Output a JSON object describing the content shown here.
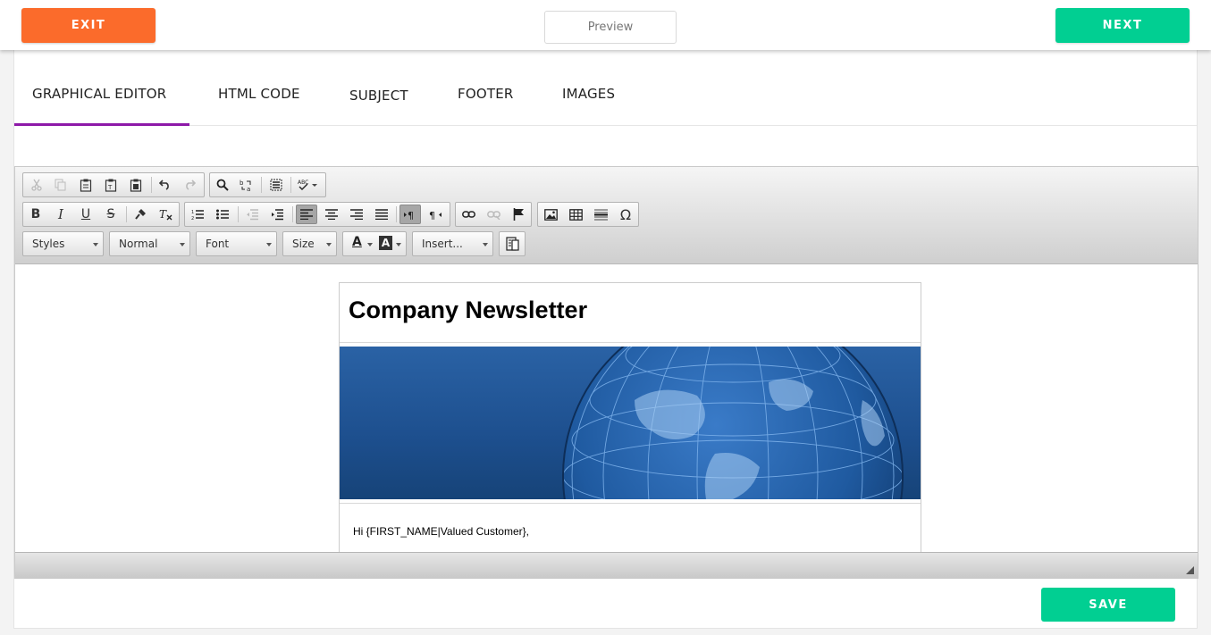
{
  "header": {
    "exit_label": "EXIT",
    "preview_label": "Preview",
    "next_label": "NEXT"
  },
  "tabs": [
    {
      "label": "GRAPHICAL EDITOR",
      "active": true
    },
    {
      "label": "HTML CODE"
    },
    {
      "label": "SUBJECT"
    },
    {
      "label": "FOOTER"
    },
    {
      "label": "IMAGES"
    }
  ],
  "toolbar": {
    "row1": [
      "cut-icon",
      "copy-icon",
      "paste-icon",
      "paste-text-icon",
      "paste-word-icon",
      "undo-icon",
      "redo-icon",
      "find-icon",
      "replace-icon",
      "select-all-icon",
      "spellcheck-icon"
    ],
    "row2": [
      "bold-icon",
      "italic-icon",
      "underline-icon",
      "strikethrough-icon",
      "format-painter-icon",
      "remove-format-icon",
      "numbered-list-icon",
      "bulleted-list-icon",
      "outdent-icon",
      "indent-icon",
      "align-left-icon",
      "align-center-icon",
      "align-right-icon",
      "justify-icon",
      "ltr-icon",
      "rtl-icon",
      "link-icon",
      "unlink-icon",
      "anchor-icon",
      "image-icon",
      "table-icon",
      "horizontal-line-icon",
      "special-char-icon"
    ],
    "styles_label": "Styles",
    "format_label": "Normal",
    "font_label": "Font",
    "size_label": "Size",
    "text_color_glyph": "A",
    "bg_color_glyph": "A",
    "insert_label": "Insert...",
    "bold_glyph": "B",
    "italic_glyph": "I",
    "underline_glyph": "U",
    "strike_glyph": "S",
    "omega_glyph": "Ω"
  },
  "newsletter": {
    "title": "Company Newsletter",
    "greeting": "Hi {FIRST_NAME|Valued Customer},"
  },
  "footer": {
    "save_label": "SAVE"
  },
  "colors": {
    "exit": "#fb6b2b",
    "next": "#01cf92",
    "save": "#01cf92",
    "tab_underline": "#8e19a8",
    "banner": "#1d4f8e"
  }
}
